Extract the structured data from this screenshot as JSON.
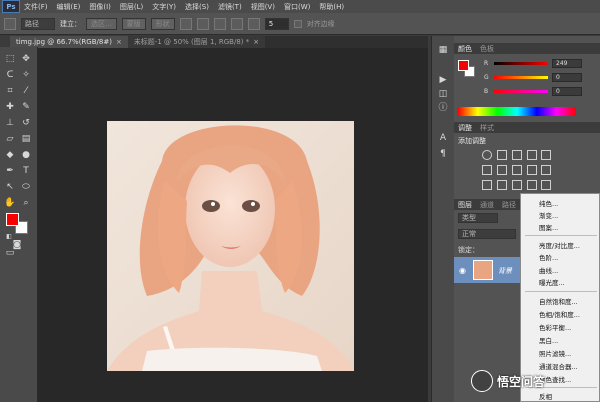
{
  "app": {
    "logo": "Ps"
  },
  "menubar": {
    "items": [
      "文件(F)",
      "编辑(E)",
      "图像(I)",
      "图层(L)",
      "文字(Y)",
      "选择(S)",
      "滤镜(T)",
      "视图(V)",
      "窗口(W)",
      "帮助(H)"
    ]
  },
  "options": {
    "path_mode": "路径",
    "make_label": "建立：",
    "selection_btn": "选区...",
    "mask_btn": "蒙版",
    "shape_btn": "形状",
    "corner_value": "5",
    "align_edges": "对齐边缘"
  },
  "tabs": [
    {
      "label": "timg.jpg @ 66.7%(RGB/8#)",
      "close": "×"
    },
    {
      "label": "未标题-1 @ 50% (图层 1, RGB/8) *",
      "close": "×"
    }
  ],
  "color_panel": {
    "tabs": [
      "颜色",
      "色板"
    ],
    "channels": [
      {
        "label": "R",
        "value": "249"
      },
      {
        "label": "G",
        "value": "0"
      },
      {
        "label": "B",
        "value": "0"
      }
    ]
  },
  "adjust_panel": {
    "tabs": [
      "调整",
      "样式"
    ],
    "title": "添加调整"
  },
  "layers_panel": {
    "tabs": [
      "图层",
      "通道",
      "路径"
    ],
    "kind": "类型",
    "blend": "正常",
    "lock": "锁定：",
    "layer_name": "背景"
  },
  "context_menu": {
    "items": [
      "纯色...",
      "渐变...",
      "图案...",
      "亮度/对比度...",
      "色阶...",
      "曲线...",
      "曝光度...",
      "自然饱和度...",
      "色相/饱和度...",
      "色彩平衡...",
      "黑白...",
      "照片滤镜...",
      "通道混合器...",
      "颜色查找...",
      "反相"
    ]
  },
  "watermark": {
    "text": "悟空问答"
  },
  "colors": {
    "foreground": "#f90000",
    "background": "#ffffff",
    "layer_selected": "#6d8fbd"
  }
}
